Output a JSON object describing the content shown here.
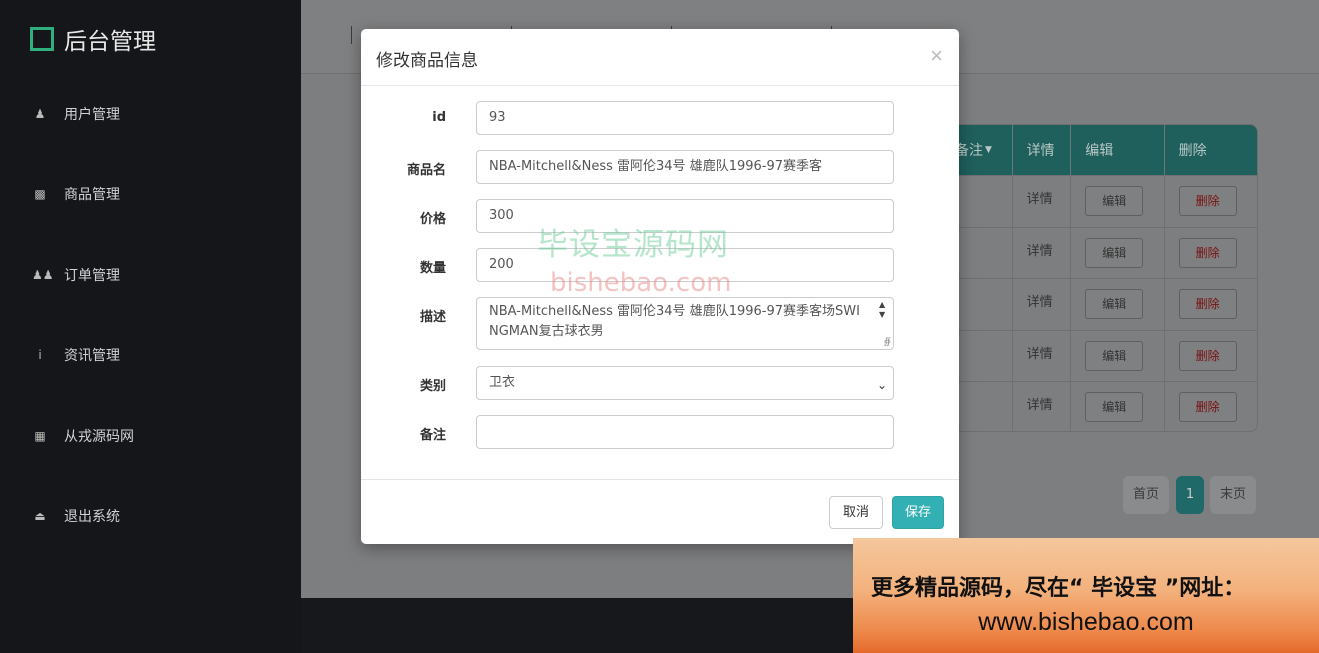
{
  "sidebar": {
    "title": "后台管理",
    "items": [
      {
        "icon": "user-icon",
        "glyph": "👤",
        "label": "用户管理"
      },
      {
        "icon": "bar-chart-icon",
        "glyph": "📊",
        "label": "商品管理"
      },
      {
        "icon": "users-icon",
        "glyph": "👥",
        "label": "订单管理"
      },
      {
        "icon": "info-icon",
        "glyph": "ℹ",
        "label": "资讯管理"
      },
      {
        "icon": "gift-icon",
        "glyph": "🎁",
        "label": "从戎源码网"
      },
      {
        "icon": "eject-icon",
        "glyph": "⏏",
        "label": "退出系统"
      }
    ]
  },
  "table": {
    "headers": {
      "remark": "备注",
      "detail": "详情",
      "edit": "编辑",
      "delete": "删除"
    },
    "rows": [
      {
        "detail": "详情",
        "edit": "编辑",
        "delete": "删除"
      },
      {
        "detail": "详情",
        "edit": "编辑",
        "delete": "删除"
      },
      {
        "detail": "详情",
        "edit": "编辑",
        "delete": "删除"
      },
      {
        "detail": "详情",
        "edit": "编辑",
        "delete": "删除"
      },
      {
        "detail": "详情",
        "edit": "编辑",
        "delete": "删除"
      }
    ]
  },
  "pager": {
    "first": "首页",
    "current": "1",
    "last": "末页"
  },
  "modal": {
    "title": "修改商品信息",
    "close": "×",
    "fields": {
      "id": {
        "label": "id",
        "value": "93"
      },
      "name": {
        "label": "商品名",
        "value": "NBA-Mitchell&Ness 雷阿伦34号 雄鹿队1996-97赛季客"
      },
      "price": {
        "label": "价格",
        "value": "300"
      },
      "quantity": {
        "label": "数量",
        "value": "200"
      },
      "description": {
        "label": "描述",
        "value": "NBA-Mitchell&Ness 雷阿伦34号 雄鹿队1996-97赛季客场SWINGMAN复古球衣男"
      },
      "category": {
        "label": "类别",
        "value": "卫衣"
      },
      "remark": {
        "label": "备注",
        "value": ""
      }
    },
    "cancel_label": "取消",
    "save_label": "保存"
  },
  "watermark": {
    "line1": "毕设宝源码网",
    "line2": "bishebao.com"
  },
  "banner": {
    "line1": "更多精品源码，尽在“ 毕设宝 ”网址：",
    "line2": "www.bishebao.com"
  }
}
